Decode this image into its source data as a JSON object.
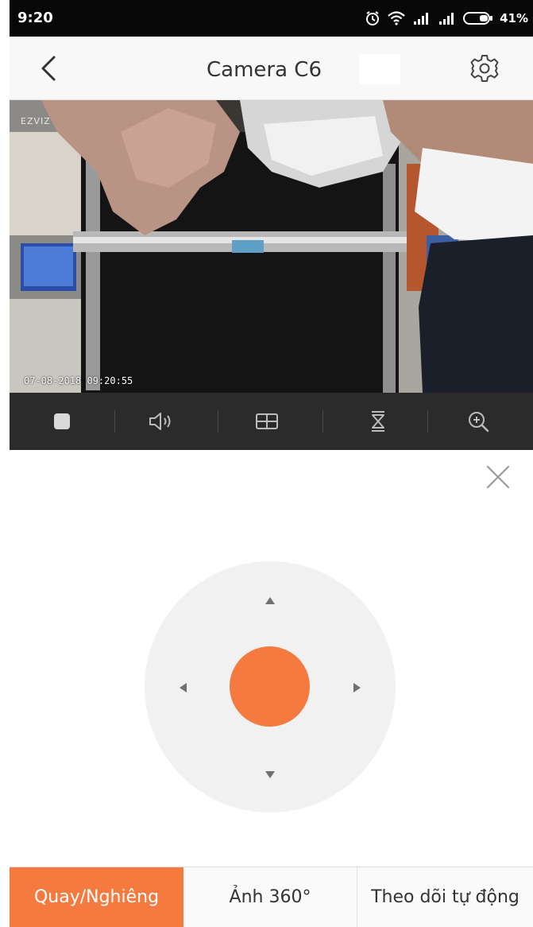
{
  "status_bar": {
    "time": "9:20",
    "battery_percent": "41%",
    "icons": [
      "alarm-icon",
      "wifi-icon",
      "signal-icon",
      "signal-icon",
      "battery-icon"
    ]
  },
  "nav": {
    "title": "Camera C6",
    "back_icon": "chevron-left-icon",
    "settings_icon": "gear-icon"
  },
  "video": {
    "watermark": "EZVIZ",
    "timestamp": "07-08-2018 09:20:55"
  },
  "toolbar": {
    "items": [
      "stop-icon",
      "speaker-icon",
      "layout-icon",
      "ptz-icon",
      "zoom-in-icon"
    ]
  },
  "ptz_panel": {
    "close_icon": "close-icon",
    "controls": [
      "up",
      "down",
      "left",
      "right",
      "center"
    ]
  },
  "tabs": [
    {
      "label": "Quay/Nghiêng",
      "active": true
    },
    {
      "label": "Ảnh 360°",
      "active": false
    },
    {
      "label": "Theo dõi tự động",
      "active": false
    }
  ],
  "colors": {
    "accent": "#f47a3f",
    "toolbar_bg": "#2b2b2b",
    "status_bg": "#080808"
  }
}
